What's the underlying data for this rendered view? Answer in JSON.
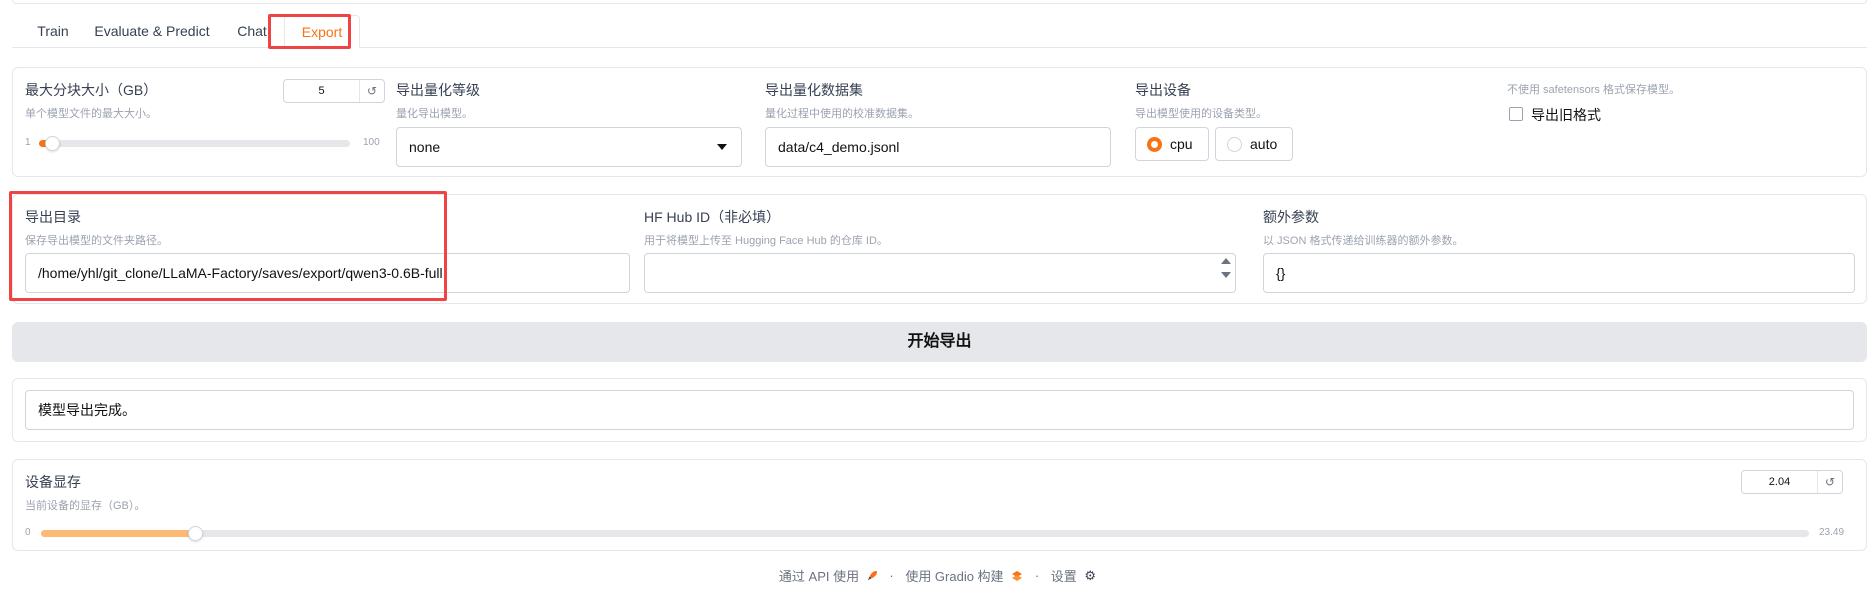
{
  "tabs": [
    {
      "label": "Train"
    },
    {
      "label": "Evaluate & Predict"
    },
    {
      "label": "Chat"
    },
    {
      "label": "Export"
    }
  ],
  "row1": {
    "max_shard": {
      "label": "最大分块大小（GB）",
      "info": "单个模型文件的最大大小。",
      "value": "5",
      "min": "1",
      "max": "100",
      "value_num": 5,
      "min_num": 1,
      "max_num": 100
    },
    "quant_bit": {
      "label": "导出量化等级",
      "info": "量化导出模型。",
      "value": "none"
    },
    "quant_dataset": {
      "label": "导出量化数据集",
      "info": "量化过程中使用的校准数据集。",
      "value": "data/c4_demo.jsonl"
    },
    "device": {
      "label": "导出设备",
      "info": "导出模型使用的设备类型。",
      "options": [
        "cpu",
        "auto"
      ],
      "selected": "cpu"
    },
    "legacy": {
      "info": "不使用 safetensors 格式保存模型。",
      "label": "导出旧格式"
    }
  },
  "row2": {
    "export_dir": {
      "label": "导出目录",
      "info": "保存导出模型的文件夹路径。",
      "value": "/home/yhl/git_clone/LLaMA-Factory/saves/export/qwen3-0.6B-full"
    },
    "hub_id": {
      "label": "HF Hub ID（非必填）",
      "info": "用于将模型上传至 Hugging Face Hub 的仓库 ID。",
      "value": ""
    },
    "extra_args": {
      "label": "额外参数",
      "info": "以 JSON 格式传递给训练器的额外参数。",
      "value": "{}"
    }
  },
  "export_button": "开始导出",
  "output_text": "模型导出完成。",
  "device_memory": {
    "label": "设备显存",
    "info": "当前设备的显存（GB）。",
    "value": "2.04",
    "min": "0",
    "max": "23.49",
    "value_num": 2.04,
    "min_num": 0,
    "max_num": 23.49
  },
  "footer": {
    "api": "通过 API 使用",
    "built": "使用 Gradio 构建",
    "settings": "设置",
    "separator": "·"
  },
  "colors": {
    "accent": "#f97316",
    "highlight": "#ef4444"
  }
}
